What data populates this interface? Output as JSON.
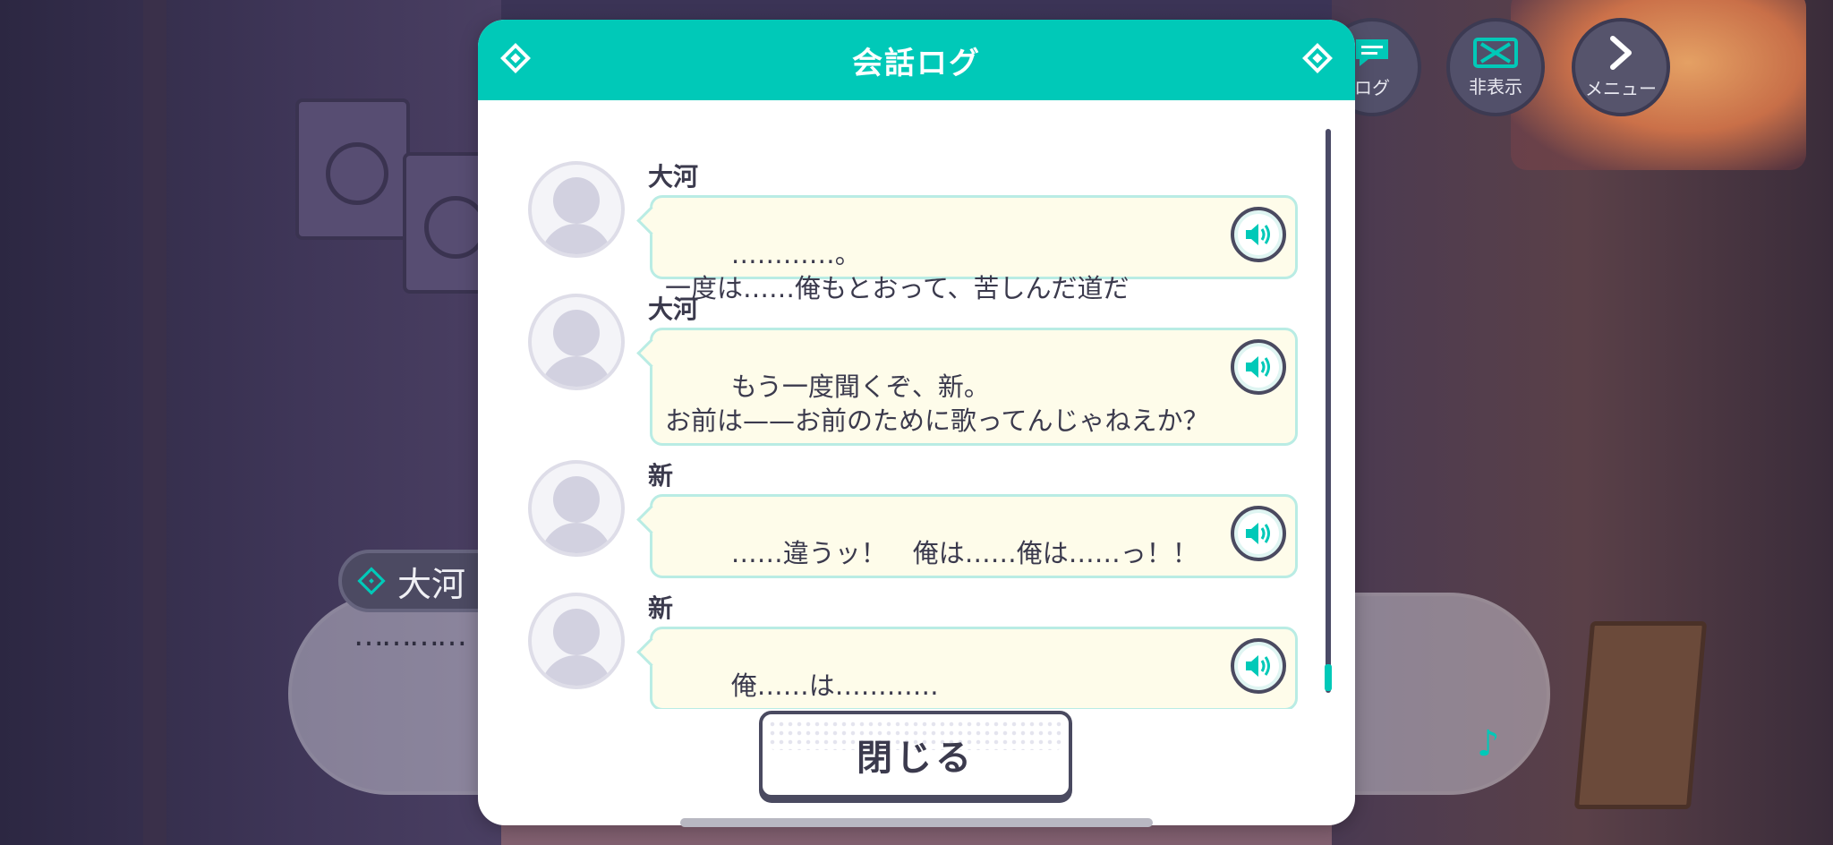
{
  "modal": {
    "title": "会話ログ",
    "close_label": "閉じる"
  },
  "log_entries": [
    {
      "speaker": "大河",
      "text": "…………。\n一度は……俺もとおって、苦しんだ道だ"
    },
    {
      "speaker": "大河",
      "text": "もう一度聞くぞ、新。\nお前は——お前のために歌ってんじゃねえか？"
    },
    {
      "speaker": "新",
      "text": "……違うッ！　俺は……俺は……っ！！"
    },
    {
      "speaker": "新",
      "text": "俺……は…………"
    }
  ],
  "hud": {
    "log_label": "ログ",
    "hide_label": "非表示",
    "menu_label": "メニュー"
  },
  "background_dialogue": {
    "speaker": "大河",
    "text": "…………"
  },
  "colors": {
    "accent": "#00c9b8",
    "bubble_fill": "#fefcea",
    "bubble_border": "#b9ece4",
    "text": "#3b3a4d"
  },
  "icons": {
    "voice": "speaker-icon",
    "avatar": "avatar-placeholder-icon",
    "log": "chat-bubble-icon",
    "hide": "hide-x-icon",
    "menu": "chevron-right-icon"
  }
}
